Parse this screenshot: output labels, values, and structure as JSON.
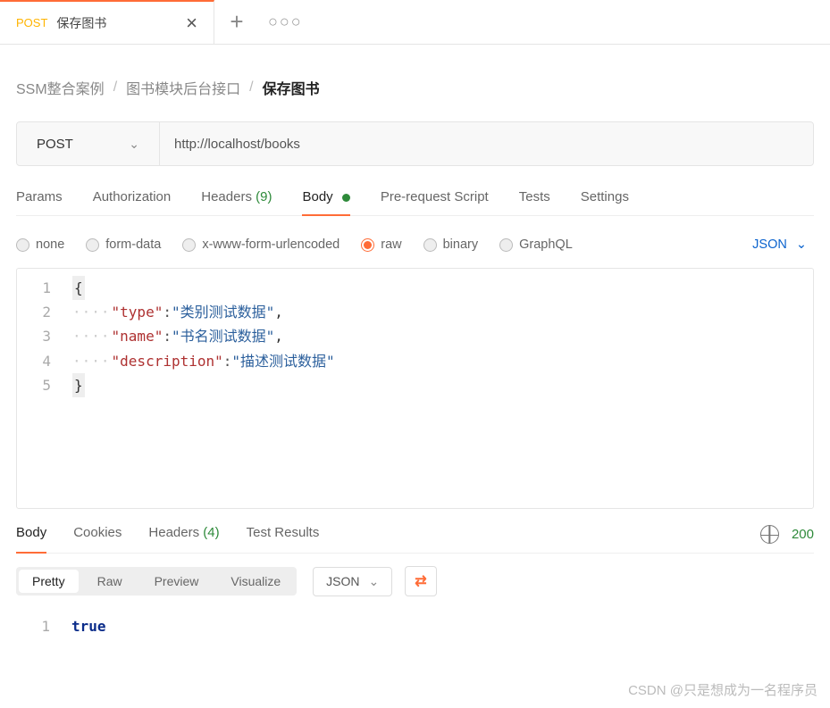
{
  "tab": {
    "method": "POST",
    "title": "保存图书"
  },
  "breadcrumb": {
    "a": "SSM整合案例",
    "b": "图书模块后台接口",
    "c": "保存图书"
  },
  "url_bar": {
    "method": "POST",
    "url": "http://localhost/books"
  },
  "req_tabs": {
    "params": "Params",
    "auth": "Authorization",
    "headers": "Headers",
    "headers_count": "(9)",
    "body": "Body",
    "prescript": "Pre-request Script",
    "tests": "Tests",
    "settings": "Settings"
  },
  "body_types": {
    "none": "none",
    "formdata": "form-data",
    "xwww": "x-www-form-urlencoded",
    "raw": "raw",
    "binary": "binary",
    "graphql": "GraphQL",
    "json": "JSON"
  },
  "editor_lines": {
    "l1": "{",
    "l2_key": "\"type\"",
    "l2_val": "\"类别测试数据\"",
    "l3_key": "\"name\"",
    "l3_val": "\"书名测试数据\"",
    "l4_key": "\"description\"",
    "l4_val": "\"描述测试数据\"",
    "l5": "}"
  },
  "resp_tabs": {
    "body": "Body",
    "cookies": "Cookies",
    "headers": "Headers",
    "headers_count": "(4)",
    "test_results": "Test Results",
    "status_code": "200"
  },
  "view_row": {
    "pretty": "Pretty",
    "raw": "Raw",
    "preview": "Preview",
    "visualize": "Visualize",
    "type": "JSON"
  },
  "resp_body": {
    "l1": "true"
  },
  "watermark": "CSDN @只是想成为一名程序员"
}
